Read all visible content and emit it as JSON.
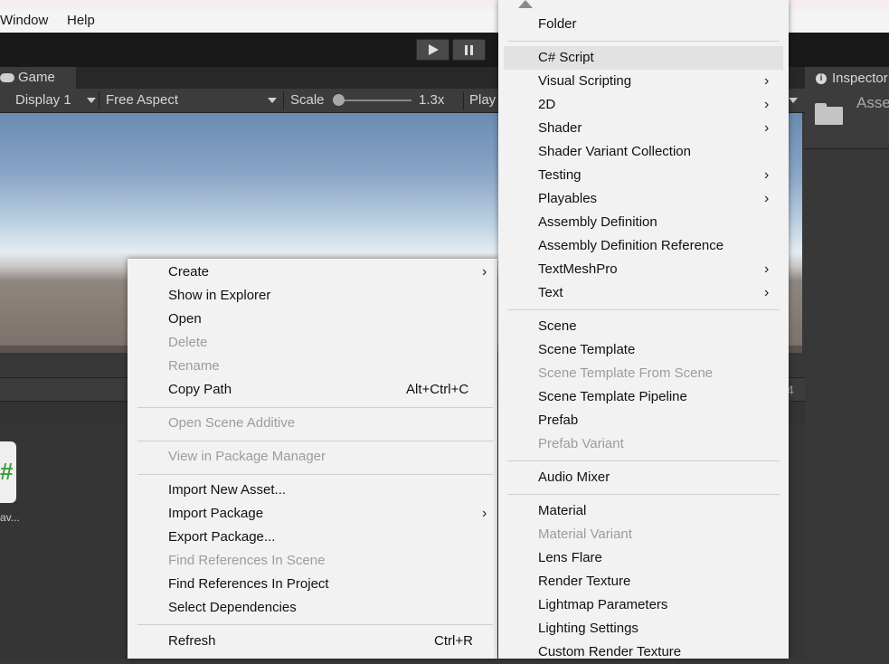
{
  "menubar": {
    "items": [
      "Window",
      "Help"
    ]
  },
  "toolbar": {
    "play_icon": "play-icon",
    "pause_icon": "pause-icon"
  },
  "game": {
    "tab_label": "Game",
    "display": "Display 1",
    "aspect": "Free Aspect",
    "scale_label": "Scale",
    "scale_value": "1.3x",
    "play_mode": "Play"
  },
  "project": {
    "asset_label": "av...",
    "side_number": "4"
  },
  "inspector": {
    "tab_label": "Inspector",
    "title": "Asse"
  },
  "context_menu": {
    "items": [
      {
        "label": "Create",
        "submenu": true,
        "highlighted": true
      },
      {
        "label": "Show in Explorer"
      },
      {
        "label": "Open"
      },
      {
        "label": "Delete",
        "disabled": true
      },
      {
        "label": "Rename",
        "disabled": true
      },
      {
        "label": "Copy Path",
        "shortcut": "Alt+Ctrl+C"
      },
      {
        "label": "Open Scene Additive",
        "disabled": true
      },
      {
        "label": "View in Package Manager",
        "disabled": true
      },
      {
        "label": "Import New Asset..."
      },
      {
        "label": "Import Package",
        "submenu": true
      },
      {
        "label": "Export Package..."
      },
      {
        "label": "Find References In Scene",
        "disabled": true
      },
      {
        "label": "Find References In Project"
      },
      {
        "label": "Select Dependencies"
      },
      {
        "label": "Refresh",
        "shortcut": "Ctrl+R"
      }
    ]
  },
  "create_menu": {
    "items": [
      {
        "label": "Folder"
      },
      {
        "label": "C# Script",
        "highlighted": true
      },
      {
        "label": "Visual Scripting",
        "submenu": true
      },
      {
        "label": "2D",
        "submenu": true
      },
      {
        "label": "Shader",
        "submenu": true
      },
      {
        "label": "Shader Variant Collection"
      },
      {
        "label": "Testing",
        "submenu": true
      },
      {
        "label": "Playables",
        "submenu": true
      },
      {
        "label": "Assembly Definition"
      },
      {
        "label": "Assembly Definition Reference"
      },
      {
        "label": "TextMeshPro",
        "submenu": true
      },
      {
        "label": "Text",
        "submenu": true
      },
      {
        "label": "Scene"
      },
      {
        "label": "Scene Template"
      },
      {
        "label": "Scene Template From Scene",
        "disabled": true
      },
      {
        "label": "Scene Template Pipeline"
      },
      {
        "label": "Prefab"
      },
      {
        "label": "Prefab Variant",
        "disabled": true
      },
      {
        "label": "Audio Mixer"
      },
      {
        "label": "Material"
      },
      {
        "label": "Material Variant",
        "disabled": true
      },
      {
        "label": "Lens Flare"
      },
      {
        "label": "Render Texture"
      },
      {
        "label": "Lightmap Parameters"
      },
      {
        "label": "Lighting Settings"
      },
      {
        "label": "Custom Render Texture"
      }
    ]
  },
  "colors": {
    "menu_bg": "#f2f2f2",
    "highlight": "#e2e2e2",
    "disabled_text": "#9c9c9c",
    "panel_bg": "#383838"
  }
}
